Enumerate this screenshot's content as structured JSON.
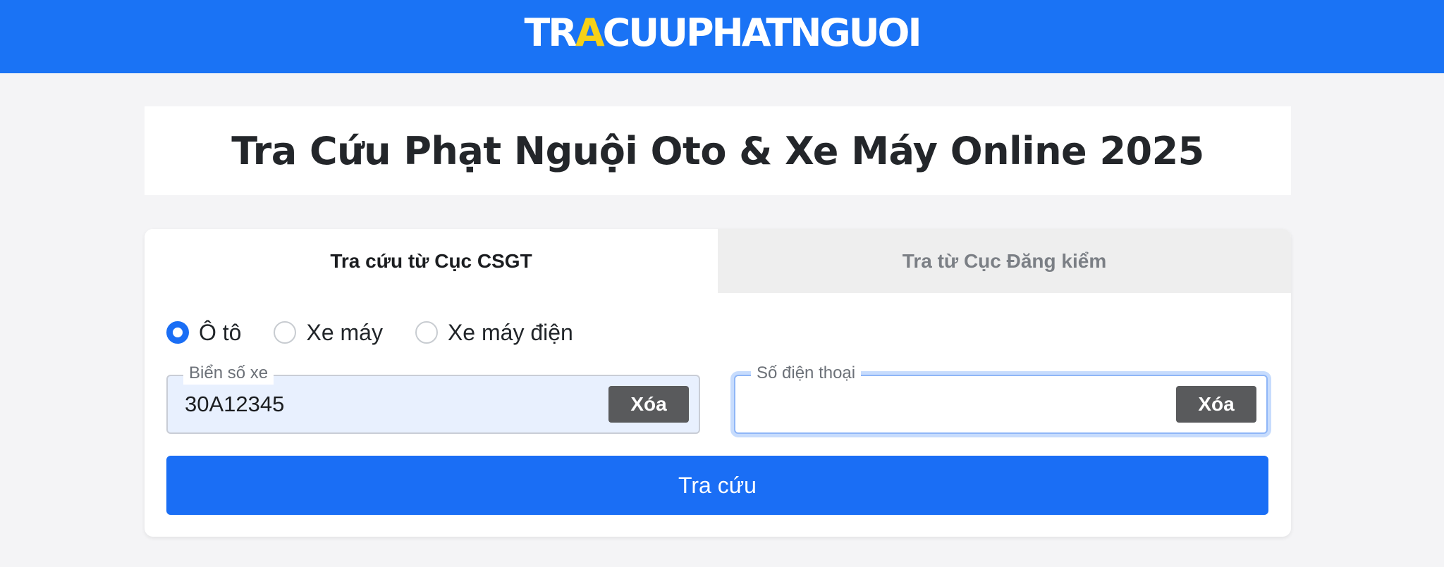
{
  "header": {
    "logo_part1": "TR",
    "logo_highlight": "A",
    "logo_part2": "CUUPHATNGUOI"
  },
  "page": {
    "title": "Tra Cứu Phạt Nguội Oto & Xe Máy Online 2025"
  },
  "tabs": [
    {
      "label": "Tra cứu từ Cục CSGT",
      "active": true
    },
    {
      "label": "Tra từ Cục Đăng kiểm",
      "active": false
    }
  ],
  "vehicle_types": [
    {
      "label": "Ô tô",
      "checked": true
    },
    {
      "label": "Xe máy",
      "checked": false
    },
    {
      "label": "Xe máy điện",
      "checked": false
    }
  ],
  "plate_field": {
    "label": "Biển số xe",
    "value": "30A12345",
    "clear_label": "Xóa"
  },
  "phone_field": {
    "label": "Số điện thoại",
    "value": "",
    "clear_label": "Xóa"
  },
  "submit_label": "Tra cứu",
  "colors": {
    "brand_blue": "#1a73f5",
    "logo_accent": "#f7d117",
    "button_blue": "#1a6ef5",
    "clear_button": "#595a5c"
  }
}
